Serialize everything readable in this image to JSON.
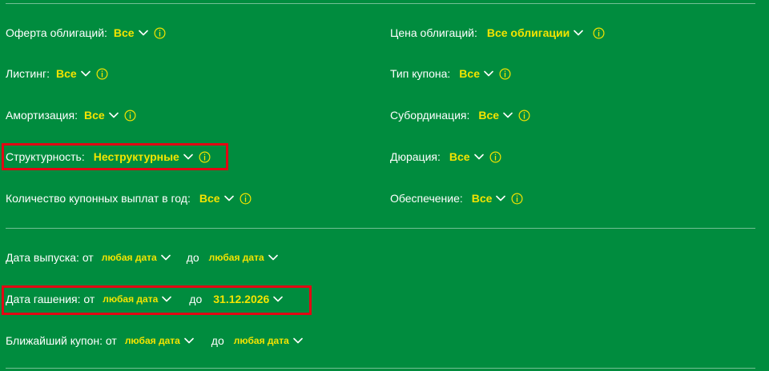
{
  "left_filters": [
    {
      "label": "Оферта облигаций:",
      "value": "Все"
    },
    {
      "label": "Листинг:",
      "value": "Все"
    },
    {
      "label": "Амортизация:",
      "value": "Все"
    },
    {
      "label": "Структурность:",
      "value": "Неструктурные"
    },
    {
      "label": "Количество купонных выплат в год:",
      "value": "Все"
    }
  ],
  "right_filters": [
    {
      "label": "Цена облигаций:",
      "value": "Все облигации"
    },
    {
      "label": "Тип купона:",
      "value": "Все"
    },
    {
      "label": "Субординация:",
      "value": "Все"
    },
    {
      "label": "Дюрация:",
      "value": "Все"
    },
    {
      "label": "Обеспечение:",
      "value": "Все"
    }
  ],
  "date_filters": [
    {
      "label": "Дата выпуска: от",
      "from": "любая дата",
      "to_label": "до",
      "to": "любая дата"
    },
    {
      "label": "Дата гашения: от",
      "from": "любая дата",
      "to_label": "до",
      "to": "31.12.2026"
    },
    {
      "label": "Ближайший купон: от",
      "from": "любая дата",
      "to_label": "до",
      "to": "любая дата"
    }
  ],
  "colors": {
    "background": "#008c3e",
    "value_text": "#f3e400",
    "highlight": "#e30613"
  },
  "icons": {
    "dropdown": "chevron-down-icon",
    "info": "info-icon"
  }
}
